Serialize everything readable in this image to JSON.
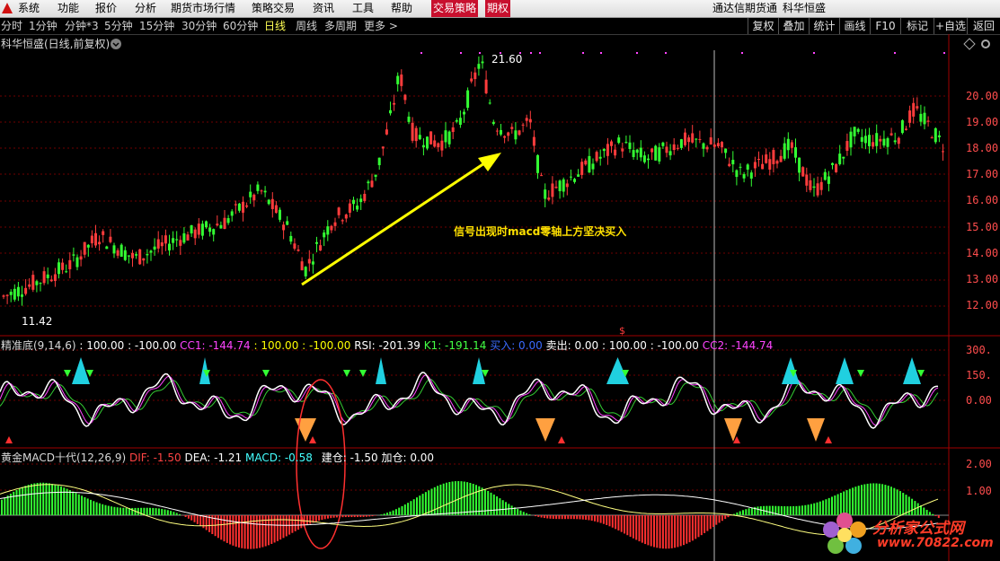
{
  "menubar": {
    "items": [
      "系统",
      "功能",
      "报价",
      "分析",
      "期货市场行情",
      "策略交易",
      "资讯",
      "工具",
      "帮助",
      "交易策略",
      "期权"
    ],
    "right": [
      "通达信期货通",
      "科华恒盛"
    ]
  },
  "periodbar": {
    "periods": [
      "分时",
      "1分钟",
      "分钟*3",
      "5分钟",
      "15分钟",
      "30分钟",
      "60分钟",
      "日线",
      "周线",
      "多周期",
      "更多 >"
    ],
    "active_index": 7,
    "buttons": [
      "复权",
      "叠加",
      "统计",
      "画线",
      "F10",
      "标记",
      "+自选",
      "返回"
    ]
  },
  "main_panel": {
    "title": "科华恒盛(日线,前复权)",
    "price_ticks": [
      "20.00",
      "19.00",
      "18.00",
      "17.00",
      "16.00",
      "15.00",
      "14.00",
      "13.00",
      "12.00"
    ],
    "high_label": "21.60",
    "low_label": "11.42",
    "annotation": "信号出现时macd零轴上方坚决买入"
  },
  "indicator1": {
    "name": "精准底(9,14,6)",
    "values": [
      {
        "text": ": 100.00",
        "color": "#ffffff"
      },
      {
        "text": ": -100.00",
        "color": "#ffffff"
      },
      {
        "text": "CC1: -144.74",
        "color": "#ff44ff"
      },
      {
        "text": ": 100.00",
        "color": "#ffff00"
      },
      {
        "text": ": -100.00",
        "color": "#ffff00"
      },
      {
        "text": "RSI: -201.39",
        "color": "#ffffff"
      },
      {
        "text": "K1: -191.14",
        "color": "#44ff44"
      },
      {
        "text": "买入: 0.00",
        "color": "#3b6bff"
      },
      {
        "text": "卖出: 0.00",
        "color": "#ffffff"
      },
      {
        "text": ": 100.00",
        "color": "#ffffff"
      },
      {
        "text": ": -100.00",
        "color": "#ffffff"
      },
      {
        "text": "CC2: -144.74",
        "color": "#ff44ff"
      }
    ],
    "ticks": [
      "300.",
      "150.",
      "0.00"
    ]
  },
  "indicator2": {
    "name": "黄金MACD十代(12,26,9)",
    "values": [
      {
        "text": "DIF: -1.50",
        "color": "#ff4444"
      },
      {
        "text": "DEA: -1.21",
        "color": "#ffffff"
      },
      {
        "text": "MACD: -0.58",
        "color": "#44ffff"
      },
      {
        "text": "建仓: -1.50",
        "color": "#ffffff"
      },
      {
        "text": "加仓: 0.00",
        "color": "#ffffff"
      }
    ],
    "ticks": [
      "2.00",
      "1.00"
    ]
  },
  "watermark": {
    "line1": "分析家公式网",
    "line2": "www.70822.com"
  }
}
